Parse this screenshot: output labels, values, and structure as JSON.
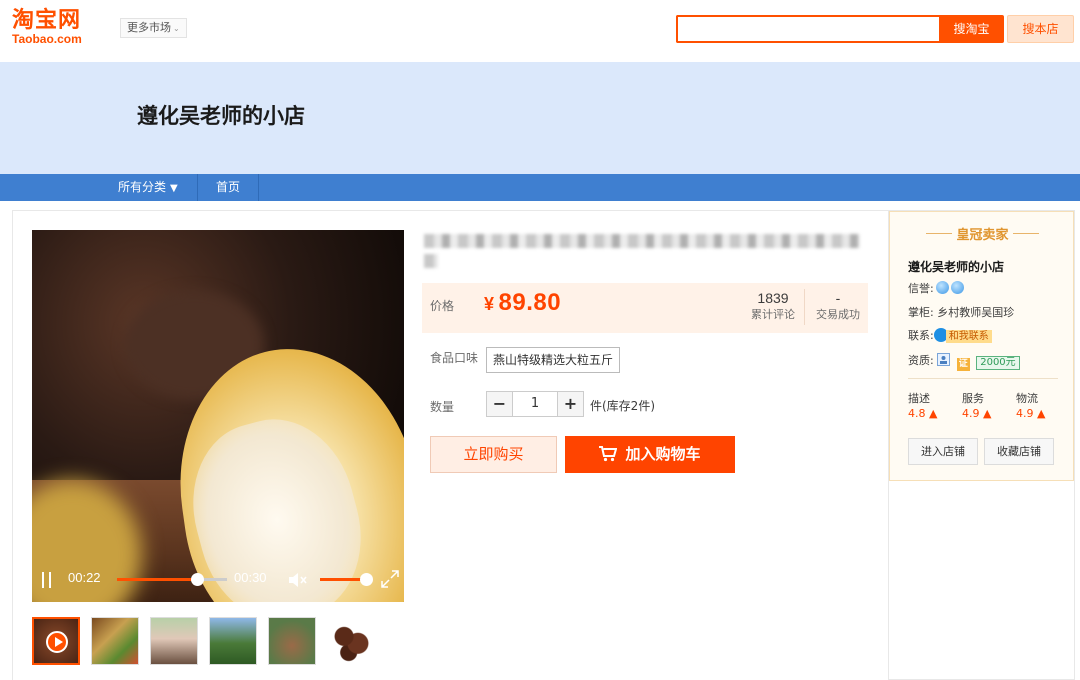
{
  "header": {
    "logo_cn": "淘宝网",
    "logo_en": "Taobao.com",
    "more_markets": "更多市场",
    "search_value": "",
    "search_taobao_btn": "搜淘宝",
    "search_shop_btn": "搜本店",
    "accent": "#ff5000"
  },
  "shop": {
    "name": "遵化吴老师的小店",
    "banner_color": "#dbe8fb"
  },
  "nav": {
    "all_categories": "所有分类",
    "home": "首页",
    "bar_color": "#3f7fd0"
  },
  "video": {
    "current_time": "00:22",
    "total_time": "00:30",
    "progress_fraction": 0.73,
    "volume_fraction": 0.95
  },
  "thumbnails": [
    {
      "kind": "video",
      "icon": "play-icon"
    },
    {
      "kind": "image"
    },
    {
      "kind": "image"
    },
    {
      "kind": "image"
    },
    {
      "kind": "image"
    },
    {
      "kind": "image"
    }
  ],
  "product": {
    "price_label": "价格",
    "currency": "¥",
    "price": "89.80",
    "reviews_count": "1839",
    "reviews_label": "累计评论",
    "deals_count": "-",
    "deals_label": "交易成功",
    "flavor_label": "食品口味",
    "flavor_option": "燕山特级精选大粒五斤",
    "qty_label": "数量",
    "qty_value": "1",
    "stock_text": "件(库存2件)",
    "buy_now": "立即购买",
    "add_to_cart": "加入购物车"
  },
  "seller": {
    "badge": "皇冠卖家",
    "shop_name": "遵化吴老师的小店",
    "credit_label": "信誉:",
    "keeper_label": "掌柜:",
    "keeper_name": "乡村教师吴国珍",
    "contact_label": "联系:",
    "contact_text": "和我联系",
    "qualification_label": "资质:",
    "qualification_badge": "证",
    "deposit": "2000元",
    "scores": [
      {
        "label": "描述",
        "value": "4.8"
      },
      {
        "label": "服务",
        "value": "4.9"
      },
      {
        "label": "物流",
        "value": "4.9"
      }
    ],
    "enter_shop": "进入店铺",
    "favorite_shop": "收藏店铺"
  }
}
